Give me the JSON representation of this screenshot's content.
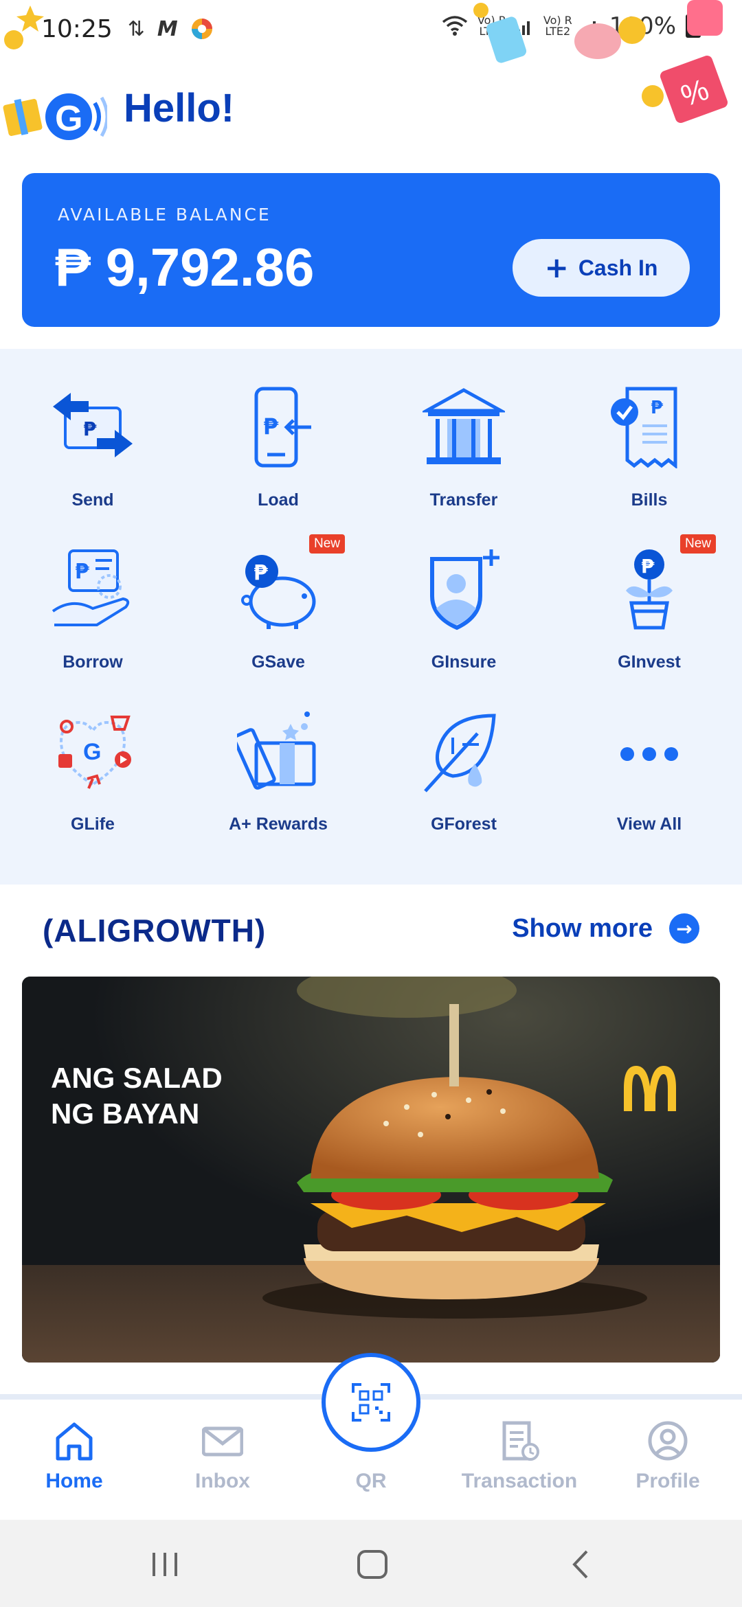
{
  "status_bar": {
    "time": "10:25",
    "network1": "LTE1",
    "network2": "LTE2",
    "battery": "100%"
  },
  "header": {
    "greeting": "Hello!"
  },
  "balance": {
    "label": "AVAILABLE BALANCE",
    "amount": "₱ 9,792.86",
    "cash_in_label": "Cash In"
  },
  "services": [
    {
      "label": "Send",
      "icon": "send-icon",
      "badge": ""
    },
    {
      "label": "Load",
      "icon": "load-icon",
      "badge": ""
    },
    {
      "label": "Transfer",
      "icon": "bank-icon",
      "badge": ""
    },
    {
      "label": "Bills",
      "icon": "bills-icon",
      "badge": ""
    },
    {
      "label": "Borrow",
      "icon": "borrow-icon",
      "badge": ""
    },
    {
      "label": "GSave",
      "icon": "piggy-bank-icon",
      "badge": "New"
    },
    {
      "label": "GInsure",
      "icon": "shield-user-icon",
      "badge": ""
    },
    {
      "label": "GInvest",
      "icon": "plant-icon",
      "badge": "New"
    },
    {
      "label": "GLife",
      "icon": "glife-icon",
      "badge": ""
    },
    {
      "label": "A+ Rewards",
      "icon": "gift-icon",
      "badge": ""
    },
    {
      "label": "GForest",
      "icon": "leaf-icon",
      "badge": ""
    },
    {
      "label": "View All",
      "icon": "more-dots-icon",
      "badge": ""
    }
  ],
  "promo": {
    "title": "(ALIGROWTH)",
    "show_more": "Show more",
    "banner_text": "ANG SALAD\nNG BAYAN"
  },
  "bottom_nav": [
    {
      "label": "Home",
      "icon": "home-icon",
      "active": true
    },
    {
      "label": "Inbox",
      "icon": "mail-icon",
      "active": false
    },
    {
      "label": "QR",
      "icon": "qr-scan-icon",
      "active": false
    },
    {
      "label": "Transaction",
      "icon": "receipt-icon",
      "active": false
    },
    {
      "label": "Profile",
      "icon": "profile-icon",
      "active": false
    }
  ],
  "colors": {
    "primary": "#1a6cf5",
    "dark_blue": "#0a3fb8",
    "services_bg": "#eef4fd",
    "badge_red": "#e9402a",
    "inactive_gray": "#b0b9cc"
  }
}
